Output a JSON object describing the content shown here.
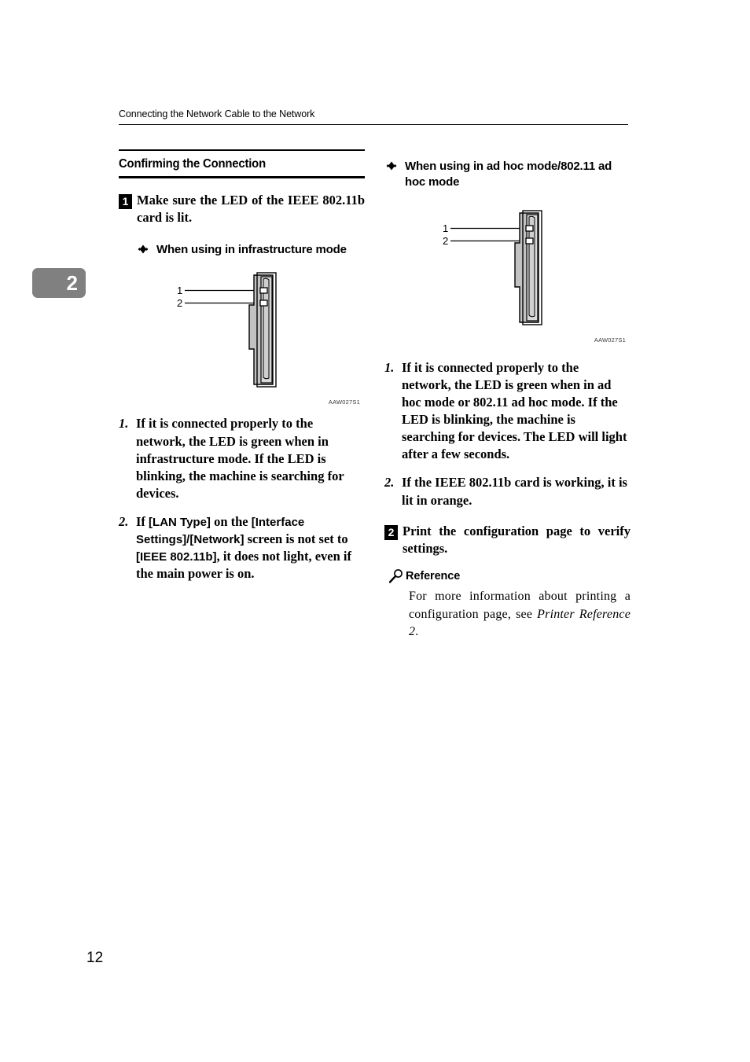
{
  "page": {
    "running_header": "Connecting the Network Cable to the Network",
    "chapter_tab": "2",
    "page_number": "12"
  },
  "left_column": {
    "section_heading": "Confirming the Connection",
    "step": {
      "badge": "1",
      "text": "Make sure the LED of the IEEE 802.11b card is lit."
    },
    "subheading": {
      "bullet": "diamond-bullet-icon",
      "text": "When using in infrastructure mode"
    },
    "figure": {
      "id": "AAW027S1",
      "callout_1": "1",
      "callout_2": "2",
      "alt": "ieee-802-11b-card-led-diagram"
    },
    "paragraphs": [
      {
        "num": "1.",
        "text": "If it is connected properly to the network, the LED is green when in infrastructure mode. If the LED is blinking, the machine is searching for devices."
      },
      {
        "num": "2.",
        "segments": [
          {
            "type": "serif",
            "text": "If "
          },
          {
            "type": "sans",
            "text": "[LAN Type]"
          },
          {
            "type": "serif",
            "text": " on the "
          },
          {
            "type": "sans",
            "text": "[Interface Settings]/[Network]"
          },
          {
            "type": "serif",
            "text": " screen is not set to "
          },
          {
            "type": "sans",
            "text": "[IEEE 802.11b]"
          },
          {
            "type": "serif",
            "text": ", it does not light, even if the main power is on."
          }
        ]
      }
    ]
  },
  "right_column": {
    "subheading": {
      "bullet": "diamond-bullet-icon",
      "text": "When using in ad hoc mode/802.11 ad hoc mode"
    },
    "figure": {
      "id": "AAW027S1",
      "callout_1": "1",
      "callout_2": "2",
      "alt": "ieee-802-11b-card-led-diagram"
    },
    "paragraphs": [
      {
        "num": "1.",
        "text": "If it is connected properly to the network, the LED is green when in ad hoc mode or 802.11 ad hoc mode. If the LED is blinking, the machine is searching for devices. The LED will light after a few seconds."
      },
      {
        "num": "2.",
        "text": "If the IEEE 802.11b card is working, it is lit in orange."
      }
    ],
    "step": {
      "badge": "2",
      "text": "Print the configuration page to verify settings."
    },
    "reference": {
      "icon": "magnifier-key-icon",
      "heading": "Reference",
      "body_before": "For more information about printing a configuration page, see ",
      "body_italic": "Printer Reference 2",
      "body_after": "."
    }
  },
  "colors": {
    "text": "#000000",
    "chapter_tab_bg": "#808080",
    "figure_body": "#c0c0c0",
    "figure_light": "#d9d9d9",
    "figure_outline": "#000000"
  }
}
